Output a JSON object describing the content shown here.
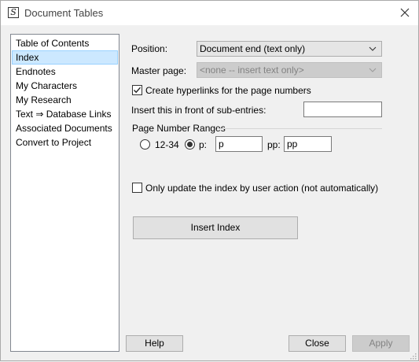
{
  "window": {
    "title": "Document Tables"
  },
  "sidebar": {
    "items": [
      {
        "label": "Table of Contents",
        "selected": false
      },
      {
        "label": "Index",
        "selected": true
      },
      {
        "label": "Endnotes",
        "selected": false
      },
      {
        "label": "My Characters",
        "selected": false
      },
      {
        "label": "My Research",
        "selected": false
      },
      {
        "label": "Text ⇒ Database Links",
        "selected": false
      },
      {
        "label": "Associated Documents",
        "selected": false
      },
      {
        "label": "Convert to Project",
        "selected": false
      }
    ]
  },
  "form": {
    "position_label": "Position:",
    "position_value": "Document end (text only)",
    "master_label": "Master page:",
    "master_value": "<none -- insert text only>",
    "hyperlinks_label": "Create hyperlinks for the page numbers",
    "hyperlinks_checked": true,
    "subentries_label": "Insert this in front of sub-entries:",
    "subentries_value": "",
    "ranges_group_label": "Page Number Ranges",
    "radio_1234_label": "12-34",
    "radio_p_label": "p:",
    "p_value": "p",
    "pp_label": "pp:",
    "pp_value": "pp",
    "selected_range_option": "p:",
    "update_label": "Only update the index by user action (not automatically)",
    "update_checked": false,
    "insert_button": "Insert Index"
  },
  "footer": {
    "help": "Help",
    "close": "Close",
    "apply": "Apply"
  },
  "icons": {
    "app": "document-tables-icon",
    "close": "close-icon",
    "dropdown": "chevron-down-icon",
    "check": "checkmark-icon"
  }
}
